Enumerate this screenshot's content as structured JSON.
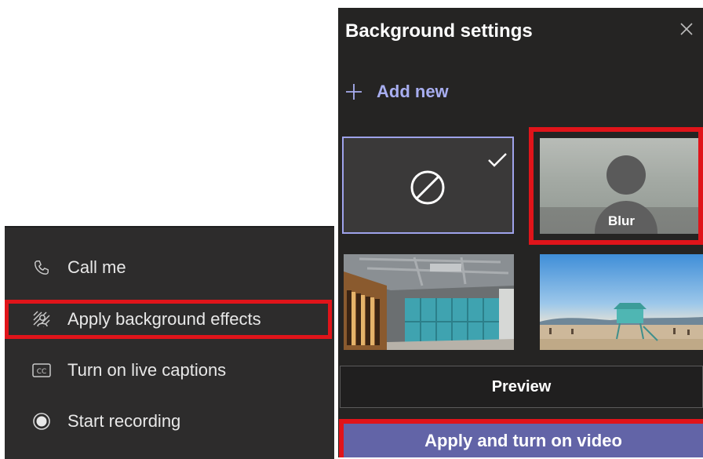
{
  "menu": {
    "items": [
      {
        "label": "Call me",
        "icon": "phone-icon"
      },
      {
        "label": "Apply background effects",
        "icon": "background-effects-icon"
      },
      {
        "label": "Turn on live captions",
        "icon": "cc-icon"
      },
      {
        "label": "Start recording",
        "icon": "record-icon"
      }
    ],
    "highlighted_item": "Apply background effects"
  },
  "panel": {
    "title": "Background settings",
    "add_new_label": "Add new",
    "tiles": [
      {
        "name": "none",
        "icon": "no-background-icon",
        "selected": true
      },
      {
        "name": "Blur",
        "label": "Blur",
        "highlighted": true
      },
      {
        "name": "office"
      },
      {
        "name": "beach"
      }
    ],
    "preview_label": "Preview",
    "apply_label": "Apply and turn on video"
  },
  "colors": {
    "panel_bg": "#252423",
    "menu_bg": "#2d2c2c",
    "accent": "#6264a7",
    "accent_text": "#a8aef0",
    "highlight": "#e0141a"
  }
}
